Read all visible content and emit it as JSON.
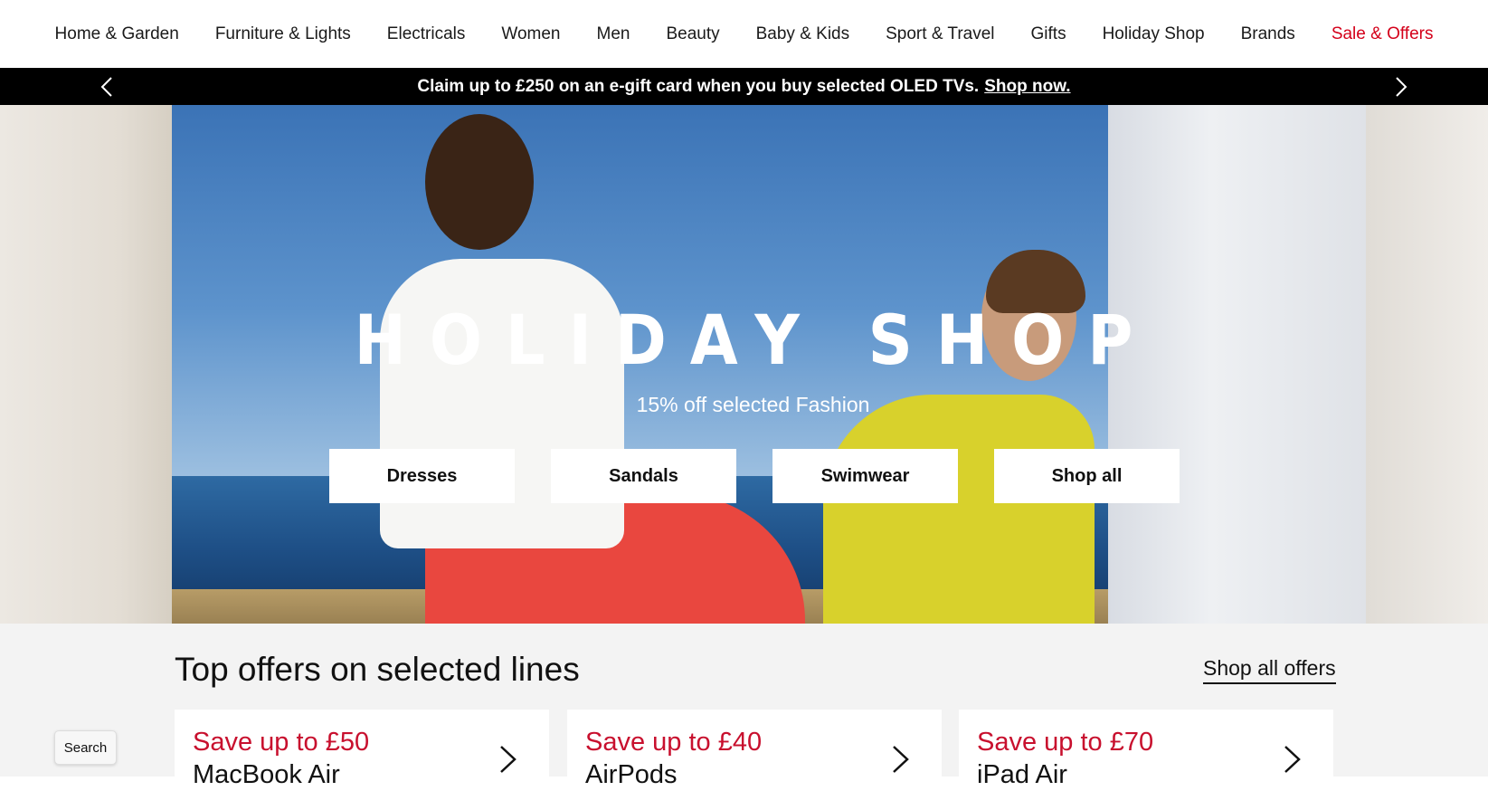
{
  "nav": {
    "items": [
      {
        "label": "Home & Garden"
      },
      {
        "label": "Furniture & Lights"
      },
      {
        "label": "Electricals"
      },
      {
        "label": "Women"
      },
      {
        "label": "Men"
      },
      {
        "label": "Beauty"
      },
      {
        "label": "Baby & Kids"
      },
      {
        "label": "Sport & Travel"
      },
      {
        "label": "Gifts"
      },
      {
        "label": "Holiday Shop"
      },
      {
        "label": "Brands"
      },
      {
        "label": "Sale & Offers"
      }
    ],
    "sale_color": "#d4001a"
  },
  "promo": {
    "text": "Claim up to £250 on an e-gift card when you buy selected OLED TVs.",
    "link": "Shop now.",
    "prev_icon": "chevron-left-icon",
    "next_icon": "chevron-right-icon"
  },
  "hero": {
    "title": "HOLIDAY SHOP",
    "subtitle": "15% off selected Fashion",
    "buttons": [
      {
        "label": "Dresses"
      },
      {
        "label": "Sandals"
      },
      {
        "label": "Swimwear"
      },
      {
        "label": "Shop all"
      }
    ]
  },
  "offers": {
    "title": "Top offers on selected lines",
    "shop_all": "Shop all offers",
    "accent_color": "#c8102e",
    "cards": [
      {
        "save": "Save up to £50",
        "product": "MacBook Air"
      },
      {
        "save": "Save up to £40",
        "product": "AirPods"
      },
      {
        "save": "Save up to £70",
        "product": "iPad Air"
      }
    ]
  },
  "search": {
    "label": "Search"
  }
}
